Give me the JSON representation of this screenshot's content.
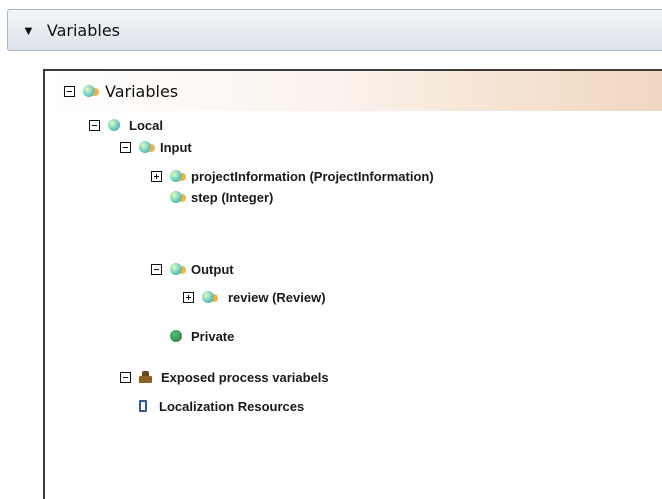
{
  "section": {
    "title": "Variables",
    "caret": "▼"
  },
  "tree": {
    "root": "Variables",
    "local": "Local",
    "input": "Input",
    "projectinformation": "projectInformation (ProjectInformation)",
    "step": "step (Integer)",
    "output": "Output",
    "review": "review (Review)",
    "private": "Private",
    "exposed": "Exposed process variabels",
    "localization": "Localization Resources"
  }
}
